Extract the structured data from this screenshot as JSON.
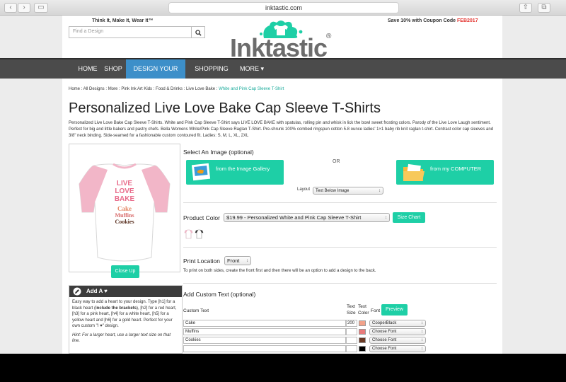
{
  "browser": {
    "url": "inktastic.com"
  },
  "header": {
    "tagline": "Think It, Make It, Wear It™",
    "promo_text": "Save 10% with Coupon Code ",
    "promo_code": "FEB2017",
    "search_placeholder": "Find a Design",
    "logo_text": "Inktastic",
    "logo_reg": "®"
  },
  "nav": {
    "items": [
      "HOME",
      "SHOP",
      "DESIGN YOUR OWN",
      "SHOPPING CART",
      "MORE ▾"
    ],
    "active": 2
  },
  "breadcrumb": {
    "path": "Home : All Designs : More : Pink Ink Art Kids : Food & Drinks : Live Love Bake : ",
    "current": "White and Pink Cap Sleeve T-Shirt"
  },
  "product": {
    "title": "Personalized Live Love Bake Cap Sleeve T-Shirts",
    "description": "Personalized Live Love Bake Cap Sleeve T-Shirts. White and Pink Cap Sleeve T-Shirt says LIVE LOVE BAKE with spatulas, rolling pin and whisk in lick the bowl sweet frosting colors. Parody of the Live Love Laugh sentiment. Perfect for big and little bakers and pastry chefs. Bella Womens White/Pink Cap Sleeve Raglan T-Shirt. Pre-shrunk 100% combed ringspun cotton 5.8 ounce ladies' 1×1 baby rib knit raglan t-shirt. Contrast color cap sleeves and 3/8\" neck binding. Side-seamed for a fashionable custom contoured fit. Ladies: S, M, L, XL, 2XL",
    "shirt_text": [
      "LIVE",
      "LOVE",
      "BAKE",
      "Cake",
      "Muffins",
      "Cookies"
    ],
    "close_up_label": "Close Up"
  },
  "tip": {
    "title": "Add A ♥",
    "body_1": "Easy way to add a heart to your design. Type [h1] for a black heart (",
    "body_bold": "include the brackets",
    "body_2": "), [h2] for a red heart, [h3] for a pink heart, [h4] for a white heart, [h5] for a yellow heart and [h6] for a gold heart. Perfect for your own custom \"I ♥\" design.",
    "hint": "Hint: For a larger heart, use a larger text size on that line."
  },
  "image_section": {
    "label": "Select An Image (optional)",
    "gallery_label": "from the Image Gallery",
    "or_label": "OR",
    "computer_label": "from my COMPUTER",
    "layout_label": "Layout",
    "layout_value": "Text Below Image"
  },
  "color_section": {
    "label": "Product Color",
    "value": "$19.99 - Personalized White and Pink Cap Sleeve T-Shirt",
    "size_chart_label": "Size Chart"
  },
  "print_section": {
    "label": "Print Location",
    "value": "Front",
    "hint": "To print on both sides, create the front first and then there will be an option to add a design to the back."
  },
  "custom_text": {
    "label": "Add Custom Text (optional)",
    "col_text": "Custom Text",
    "col_size_1": "Text",
    "col_size_2": "Size",
    "col_color_1": "Text",
    "col_color_2": "Color",
    "col_font": "Font",
    "preview_label": "Preview",
    "rows": [
      {
        "text": "Cake",
        "size": "200",
        "color": "#f2a28a",
        "font": "CooperBlack"
      },
      {
        "text": "Muffins",
        "size": "",
        "color": "#e97b7b",
        "font": "Choose Font"
      },
      {
        "text": "Cookies",
        "size": "",
        "color": "#6b3a26",
        "font": "Choose Font"
      },
      {
        "text": "",
        "size": "",
        "color": "#000000",
        "font": "Choose Font"
      }
    ]
  },
  "colors": {
    "accent": "#1ecfa6",
    "nav_bg": "#4b4b4b",
    "nav_active": "#3d8fc9",
    "promo_code": "#e3342f",
    "breadcrumb_current": "#1aab9b"
  }
}
